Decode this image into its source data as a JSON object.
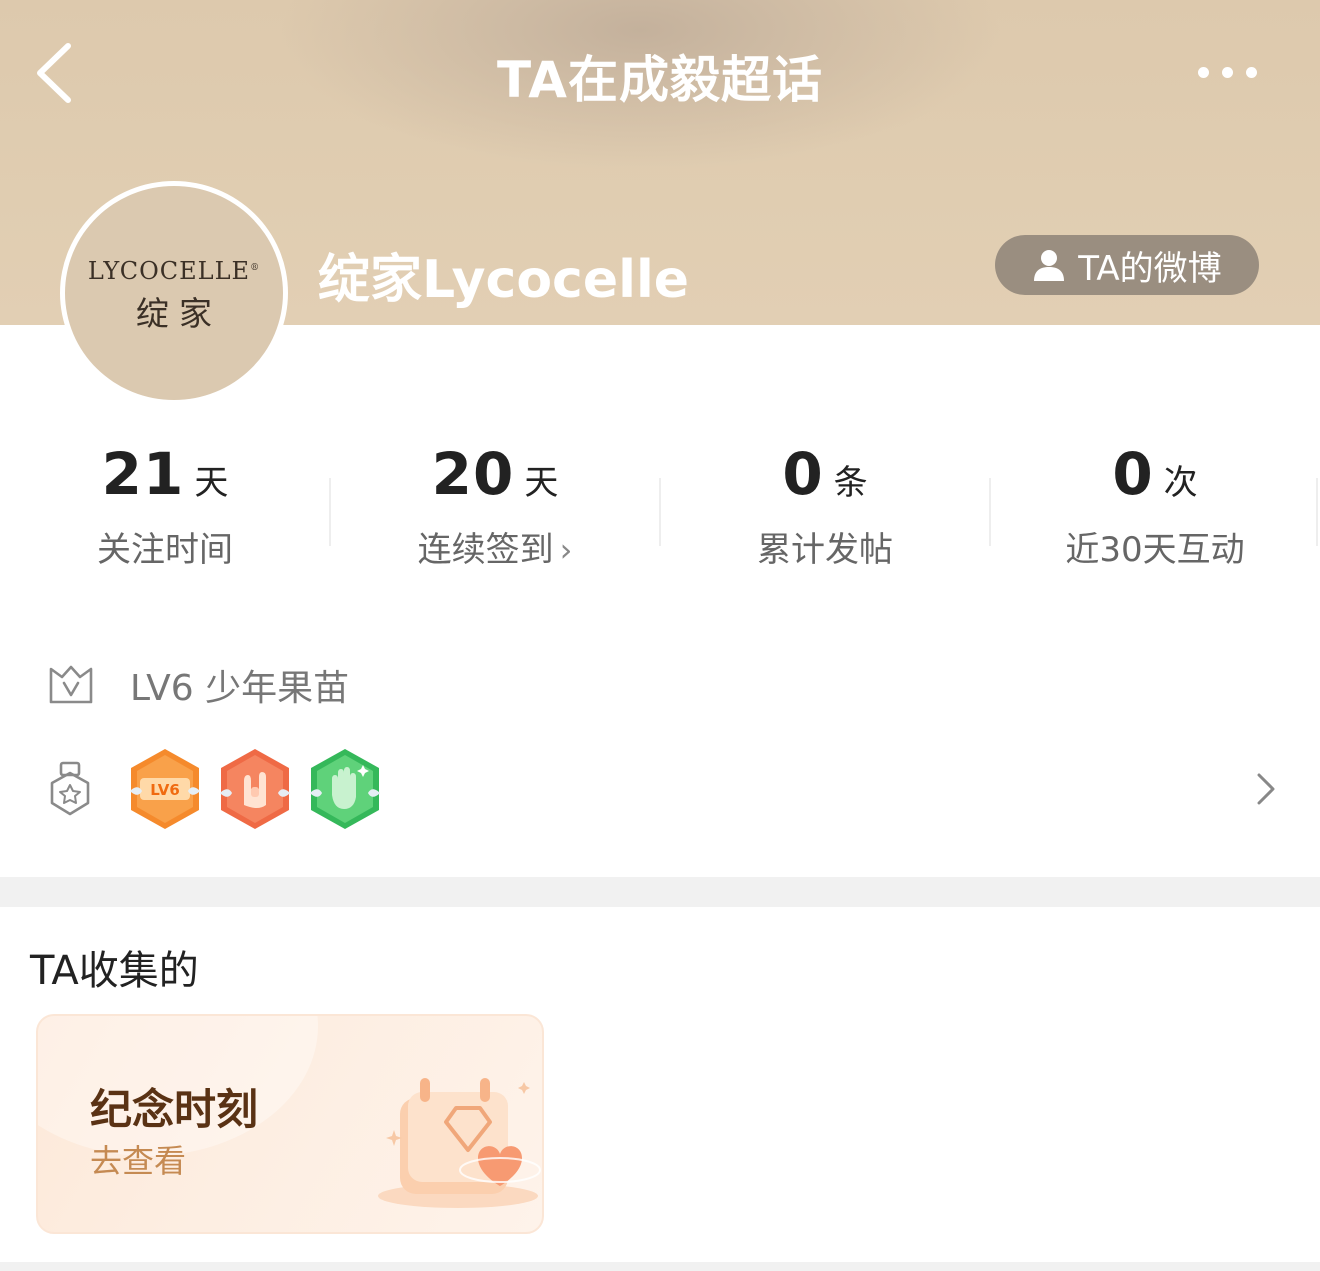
{
  "nav": {
    "title": "TA在成毅超话",
    "back_icon": "chevron-left-icon",
    "more_icon": "more-dots-icon"
  },
  "profile": {
    "avatar_brand": "LYCOCELLE",
    "avatar_brand_mark": "®",
    "avatar_cn": "绽家",
    "name": "绽家Lycocelle",
    "weibo_button": "TA的微博",
    "weibo_icon": "person-icon"
  },
  "stats": [
    {
      "value": "21",
      "unit": "天",
      "label": "关注时间"
    },
    {
      "value": "20",
      "unit": "天",
      "label": "连续签到",
      "chevron": "›"
    },
    {
      "value": "0",
      "unit": "条",
      "label": "累计发帖"
    },
    {
      "value": "0",
      "unit": "次",
      "label": "近30天互动"
    }
  ],
  "level": {
    "icon": "level-crown-icon",
    "text": "LV6 少年果苗"
  },
  "badges": {
    "icon": "medal-icon",
    "items": [
      {
        "name": "lv6-badge",
        "text": "LV6",
        "color": "#f58a2c"
      },
      {
        "name": "rock-hand-badge",
        "color": "#f06a4a"
      },
      {
        "name": "wave-hand-badge",
        "color": "#3fbf5d"
      }
    ]
  },
  "collection": {
    "title": "TA收集的",
    "card": {
      "title": "纪念时刻",
      "subtitle": "去查看"
    }
  },
  "colors": {
    "header_bg": "#e0cdb1",
    "weibo_btn_bg": "#9a8e80",
    "card_title": "#5a3214",
    "card_sub": "#c58a52"
  }
}
